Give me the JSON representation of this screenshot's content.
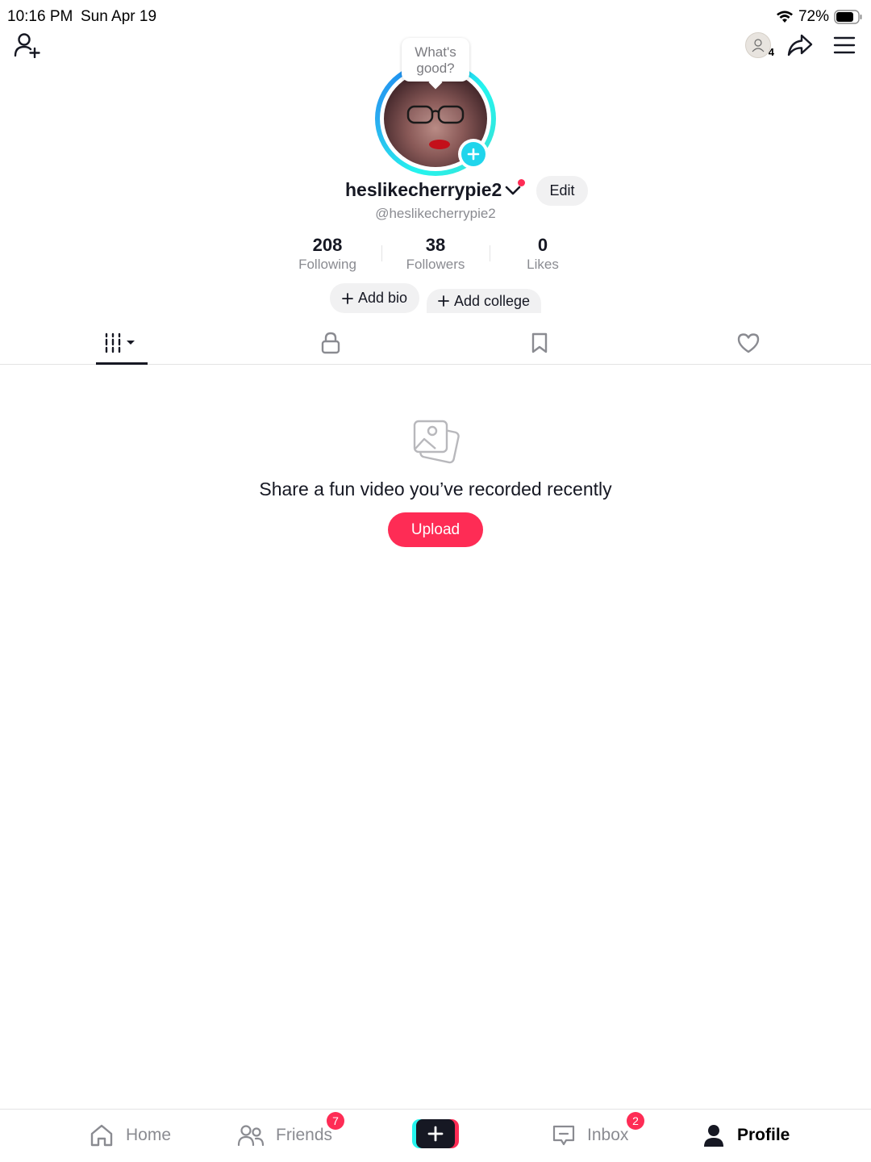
{
  "status_bar": {
    "time": "10:16 PM",
    "date": "Sun Apr 19",
    "battery": "72%"
  },
  "toolbar": {
    "visitor_count": "4"
  },
  "avatar": {
    "bubble_text": "What's good?"
  },
  "profile": {
    "username": "heslikecherrypie2",
    "handle": "@heslikecherrypie2",
    "edit_label": "Edit"
  },
  "stats": [
    {
      "value": "208",
      "label": "Following"
    },
    {
      "value": "38",
      "label": "Followers"
    },
    {
      "value": "0",
      "label": "Likes"
    }
  ],
  "chips": {
    "add_bio": "Add bio",
    "add_college": "Add college"
  },
  "tabs": [
    {
      "icon": "videos-grid-icon"
    },
    {
      "icon": "lock-icon"
    },
    {
      "icon": "bookmark-icon"
    },
    {
      "icon": "heart-icon"
    }
  ],
  "empty_state": {
    "message": "Share a fun video you’ve recorded recently",
    "upload_label": "Upload"
  },
  "bottom_nav": {
    "home": "Home",
    "friends": "Friends",
    "friends_badge": "7",
    "inbox": "Inbox",
    "inbox_badge": "2",
    "profile": "Profile"
  },
  "colors": {
    "accent": "#fe2c55",
    "cyan": "#25f4ee",
    "text": "#161823",
    "muted": "#8a8b91"
  }
}
